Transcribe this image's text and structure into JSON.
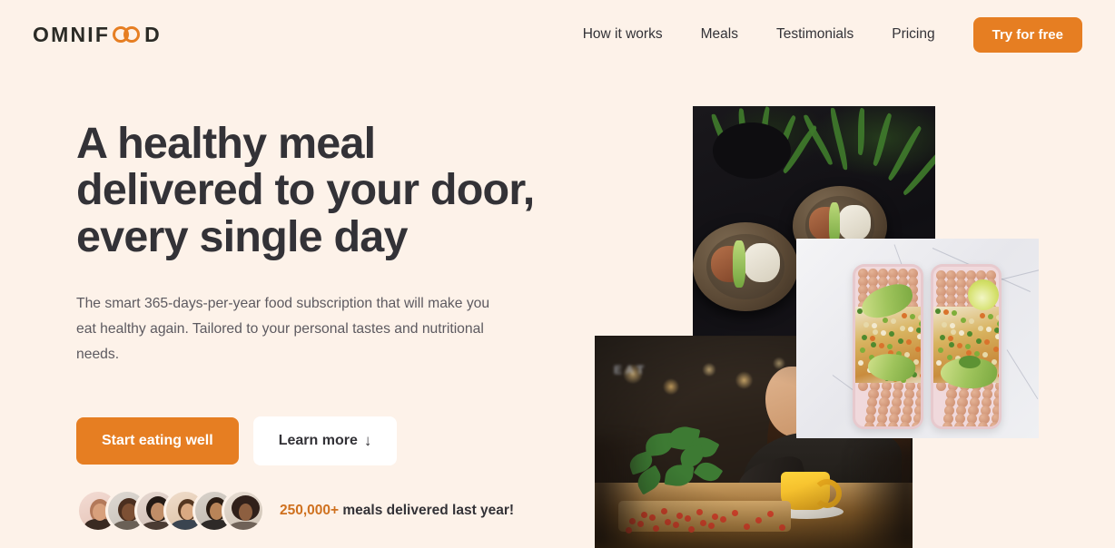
{
  "brand": {
    "name": "OMNIFOOD",
    "logo_prefix": "OMNIF",
    "logo_symbol": "infinity-oo",
    "logo_suffix": "D",
    "accent_color": "#e67e22",
    "background_color": "#fdf2e9",
    "text_color": "#333237"
  },
  "header": {
    "nav": [
      {
        "label": "How it works"
      },
      {
        "label": "Meals"
      },
      {
        "label": "Testimonials"
      },
      {
        "label": "Pricing"
      }
    ],
    "cta_label": "Try for free"
  },
  "hero": {
    "headline": "A healthy meal delivered to your door, every single day",
    "description": "The smart 365-days-per-year food subscription that will make you eat healthy again. Tailored to your personal tastes and nutritional needs.",
    "primary_button": "Start eating well",
    "secondary_button": "Learn more",
    "secondary_button_arrow": "↓",
    "social_proof": {
      "count": "250,000+",
      "text": " meals delivered last year!",
      "avatar_count": 6,
      "avatars": [
        {
          "name": "customer-1"
        },
        {
          "name": "customer-2"
        },
        {
          "name": "customer-3"
        },
        {
          "name": "customer-4"
        },
        {
          "name": "customer-5"
        },
        {
          "name": "customer-6"
        }
      ]
    },
    "images": [
      {
        "name": "bowls-on-dark-table",
        "alt": "Three ceramic bowls of food on a dark table with plants"
      },
      {
        "name": "meal-prep-boxes-on-marble",
        "alt": "Two meal prep containers with chickpeas, avocado and rice on white marble"
      },
      {
        "name": "woman-eating-at-restaurant",
        "alt": "Woman eating a salad at a restaurant table with a yellow mug"
      }
    ]
  },
  "misc": {
    "neon_sign": "EAT"
  }
}
